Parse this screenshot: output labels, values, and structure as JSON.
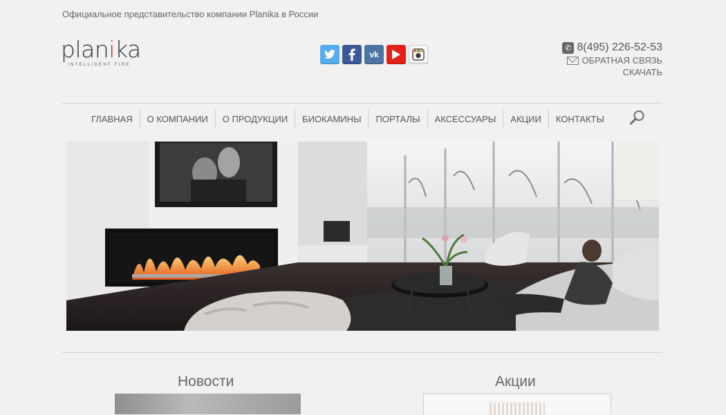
{
  "header": {
    "tagline": "Официальное представительство компании Planika в России",
    "logo": {
      "word": "planika",
      "sub": "INTELLIGENT FIRE"
    },
    "socials": [
      {
        "name": "twitter",
        "glyph": "t"
      },
      {
        "name": "facebook",
        "glyph": "f"
      },
      {
        "name": "vk",
        "glyph": "vk"
      },
      {
        "name": "youtube",
        "glyph": "▶"
      },
      {
        "name": "instagram",
        "glyph": "◙"
      }
    ],
    "phone": "8(495) 226-52-53",
    "feedback": "ОБРАТНАЯ СВЯЗЬ",
    "download": "СКАЧАТЬ"
  },
  "nav": {
    "items": [
      "ГЛАВНАЯ",
      "О КОМПАНИИ",
      "О ПРОДУКЦИИ",
      "БИОКАМИНЫ",
      "ПОРТАЛЫ",
      "АКСЕССУАРЫ",
      "АКЦИИ",
      "КОНТАКТЫ"
    ]
  },
  "sections": {
    "news_title": "Новости",
    "promo_title": "Акции"
  },
  "colors": {
    "background": "#f1f1f1",
    "text": "#555555",
    "accent": "#d8262f"
  }
}
